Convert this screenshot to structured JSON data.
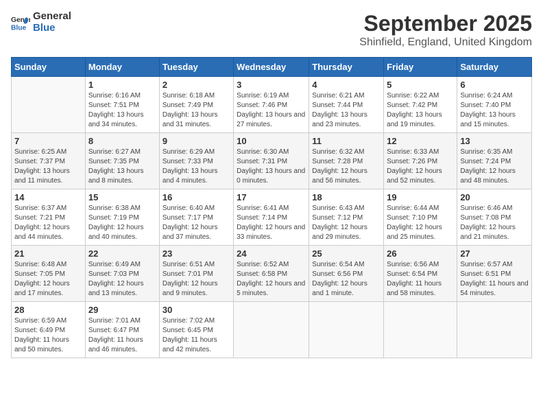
{
  "header": {
    "logo_general": "General",
    "logo_blue": "Blue",
    "month_title": "September 2025",
    "location": "Shinfield, England, United Kingdom"
  },
  "days_of_week": [
    "Sunday",
    "Monday",
    "Tuesday",
    "Wednesday",
    "Thursday",
    "Friday",
    "Saturday"
  ],
  "weeks": [
    [
      {
        "day": "",
        "sunrise": "",
        "sunset": "",
        "daylight": ""
      },
      {
        "day": "1",
        "sunrise": "Sunrise: 6:16 AM",
        "sunset": "Sunset: 7:51 PM",
        "daylight": "Daylight: 13 hours and 34 minutes."
      },
      {
        "day": "2",
        "sunrise": "Sunrise: 6:18 AM",
        "sunset": "Sunset: 7:49 PM",
        "daylight": "Daylight: 13 hours and 31 minutes."
      },
      {
        "day": "3",
        "sunrise": "Sunrise: 6:19 AM",
        "sunset": "Sunset: 7:46 PM",
        "daylight": "Daylight: 13 hours and 27 minutes."
      },
      {
        "day": "4",
        "sunrise": "Sunrise: 6:21 AM",
        "sunset": "Sunset: 7:44 PM",
        "daylight": "Daylight: 13 hours and 23 minutes."
      },
      {
        "day": "5",
        "sunrise": "Sunrise: 6:22 AM",
        "sunset": "Sunset: 7:42 PM",
        "daylight": "Daylight: 13 hours and 19 minutes."
      },
      {
        "day": "6",
        "sunrise": "Sunrise: 6:24 AM",
        "sunset": "Sunset: 7:40 PM",
        "daylight": "Daylight: 13 hours and 15 minutes."
      }
    ],
    [
      {
        "day": "7",
        "sunrise": "Sunrise: 6:25 AM",
        "sunset": "Sunset: 7:37 PM",
        "daylight": "Daylight: 13 hours and 11 minutes."
      },
      {
        "day": "8",
        "sunrise": "Sunrise: 6:27 AM",
        "sunset": "Sunset: 7:35 PM",
        "daylight": "Daylight: 13 hours and 8 minutes."
      },
      {
        "day": "9",
        "sunrise": "Sunrise: 6:29 AM",
        "sunset": "Sunset: 7:33 PM",
        "daylight": "Daylight: 13 hours and 4 minutes."
      },
      {
        "day": "10",
        "sunrise": "Sunrise: 6:30 AM",
        "sunset": "Sunset: 7:31 PM",
        "daylight": "Daylight: 13 hours and 0 minutes."
      },
      {
        "day": "11",
        "sunrise": "Sunrise: 6:32 AM",
        "sunset": "Sunset: 7:28 PM",
        "daylight": "Daylight: 12 hours and 56 minutes."
      },
      {
        "day": "12",
        "sunrise": "Sunrise: 6:33 AM",
        "sunset": "Sunset: 7:26 PM",
        "daylight": "Daylight: 12 hours and 52 minutes."
      },
      {
        "day": "13",
        "sunrise": "Sunrise: 6:35 AM",
        "sunset": "Sunset: 7:24 PM",
        "daylight": "Daylight: 12 hours and 48 minutes."
      }
    ],
    [
      {
        "day": "14",
        "sunrise": "Sunrise: 6:37 AM",
        "sunset": "Sunset: 7:21 PM",
        "daylight": "Daylight: 12 hours and 44 minutes."
      },
      {
        "day": "15",
        "sunrise": "Sunrise: 6:38 AM",
        "sunset": "Sunset: 7:19 PM",
        "daylight": "Daylight: 12 hours and 40 minutes."
      },
      {
        "day": "16",
        "sunrise": "Sunrise: 6:40 AM",
        "sunset": "Sunset: 7:17 PM",
        "daylight": "Daylight: 12 hours and 37 minutes."
      },
      {
        "day": "17",
        "sunrise": "Sunrise: 6:41 AM",
        "sunset": "Sunset: 7:14 PM",
        "daylight": "Daylight: 12 hours and 33 minutes."
      },
      {
        "day": "18",
        "sunrise": "Sunrise: 6:43 AM",
        "sunset": "Sunset: 7:12 PM",
        "daylight": "Daylight: 12 hours and 29 minutes."
      },
      {
        "day": "19",
        "sunrise": "Sunrise: 6:44 AM",
        "sunset": "Sunset: 7:10 PM",
        "daylight": "Daylight: 12 hours and 25 minutes."
      },
      {
        "day": "20",
        "sunrise": "Sunrise: 6:46 AM",
        "sunset": "Sunset: 7:08 PM",
        "daylight": "Daylight: 12 hours and 21 minutes."
      }
    ],
    [
      {
        "day": "21",
        "sunrise": "Sunrise: 6:48 AM",
        "sunset": "Sunset: 7:05 PM",
        "daylight": "Daylight: 12 hours and 17 minutes."
      },
      {
        "day": "22",
        "sunrise": "Sunrise: 6:49 AM",
        "sunset": "Sunset: 7:03 PM",
        "daylight": "Daylight: 12 hours and 13 minutes."
      },
      {
        "day": "23",
        "sunrise": "Sunrise: 6:51 AM",
        "sunset": "Sunset: 7:01 PM",
        "daylight": "Daylight: 12 hours and 9 minutes."
      },
      {
        "day": "24",
        "sunrise": "Sunrise: 6:52 AM",
        "sunset": "Sunset: 6:58 PM",
        "daylight": "Daylight: 12 hours and 5 minutes."
      },
      {
        "day": "25",
        "sunrise": "Sunrise: 6:54 AM",
        "sunset": "Sunset: 6:56 PM",
        "daylight": "Daylight: 12 hours and 1 minute."
      },
      {
        "day": "26",
        "sunrise": "Sunrise: 6:56 AM",
        "sunset": "Sunset: 6:54 PM",
        "daylight": "Daylight: 11 hours and 58 minutes."
      },
      {
        "day": "27",
        "sunrise": "Sunrise: 6:57 AM",
        "sunset": "Sunset: 6:51 PM",
        "daylight": "Daylight: 11 hours and 54 minutes."
      }
    ],
    [
      {
        "day": "28",
        "sunrise": "Sunrise: 6:59 AM",
        "sunset": "Sunset: 6:49 PM",
        "daylight": "Daylight: 11 hours and 50 minutes."
      },
      {
        "day": "29",
        "sunrise": "Sunrise: 7:01 AM",
        "sunset": "Sunset: 6:47 PM",
        "daylight": "Daylight: 11 hours and 46 minutes."
      },
      {
        "day": "30",
        "sunrise": "Sunrise: 7:02 AM",
        "sunset": "Sunset: 6:45 PM",
        "daylight": "Daylight: 11 hours and 42 minutes."
      },
      {
        "day": "",
        "sunrise": "",
        "sunset": "",
        "daylight": ""
      },
      {
        "day": "",
        "sunrise": "",
        "sunset": "",
        "daylight": ""
      },
      {
        "day": "",
        "sunrise": "",
        "sunset": "",
        "daylight": ""
      },
      {
        "day": "",
        "sunrise": "",
        "sunset": "",
        "daylight": ""
      }
    ]
  ]
}
